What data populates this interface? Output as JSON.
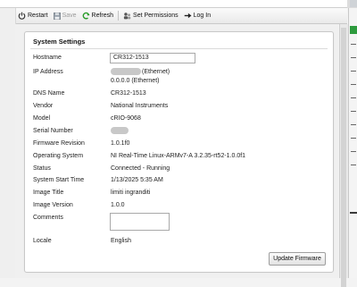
{
  "toolbar": {
    "restart": "Restart",
    "save": "Save",
    "refresh": "Refresh",
    "set_permissions": "Set Permissions",
    "login": "Log In"
  },
  "panel": {
    "title": "System Settings",
    "update_button": "Update Firmware"
  },
  "fields": {
    "hostname": {
      "label": "Hostname",
      "value": "CR312-1513"
    },
    "ip_address": {
      "label": "IP Address",
      "line1_suffix": "(Ethernet)",
      "line2": "0.0.0.0 (Ethernet)"
    },
    "dns_name": {
      "label": "DNS Name",
      "value": "CR312-1513"
    },
    "vendor": {
      "label": "Vendor",
      "value": "National Instruments"
    },
    "model": {
      "label": "Model",
      "value": "cRIO-9068"
    },
    "serial_number": {
      "label": "Serial Number",
      "value": ""
    },
    "firmware_revision": {
      "label": "Firmware Revision",
      "value": "1.0.1f0"
    },
    "operating_system": {
      "label": "Operating System",
      "value": "NI Real-Time Linux-ARMv7-A 3.2.35-rt52-1.0.0f1"
    },
    "status": {
      "label": "Status",
      "value": "Connected - Running"
    },
    "system_start_time": {
      "label": "System Start Time",
      "value": "1/13/2025 5:35 AM"
    },
    "image_title": {
      "label": "Image Title",
      "value": "limiti ingranditi"
    },
    "image_version": {
      "label": "Image Version",
      "value": "1.0.0"
    },
    "comments": {
      "label": "Comments",
      "value": ""
    },
    "locale": {
      "label": "Locale",
      "value": "English"
    }
  },
  "colors": {
    "accent_green": "#2e9b3e",
    "refresh_green": "#2a9d2a"
  }
}
